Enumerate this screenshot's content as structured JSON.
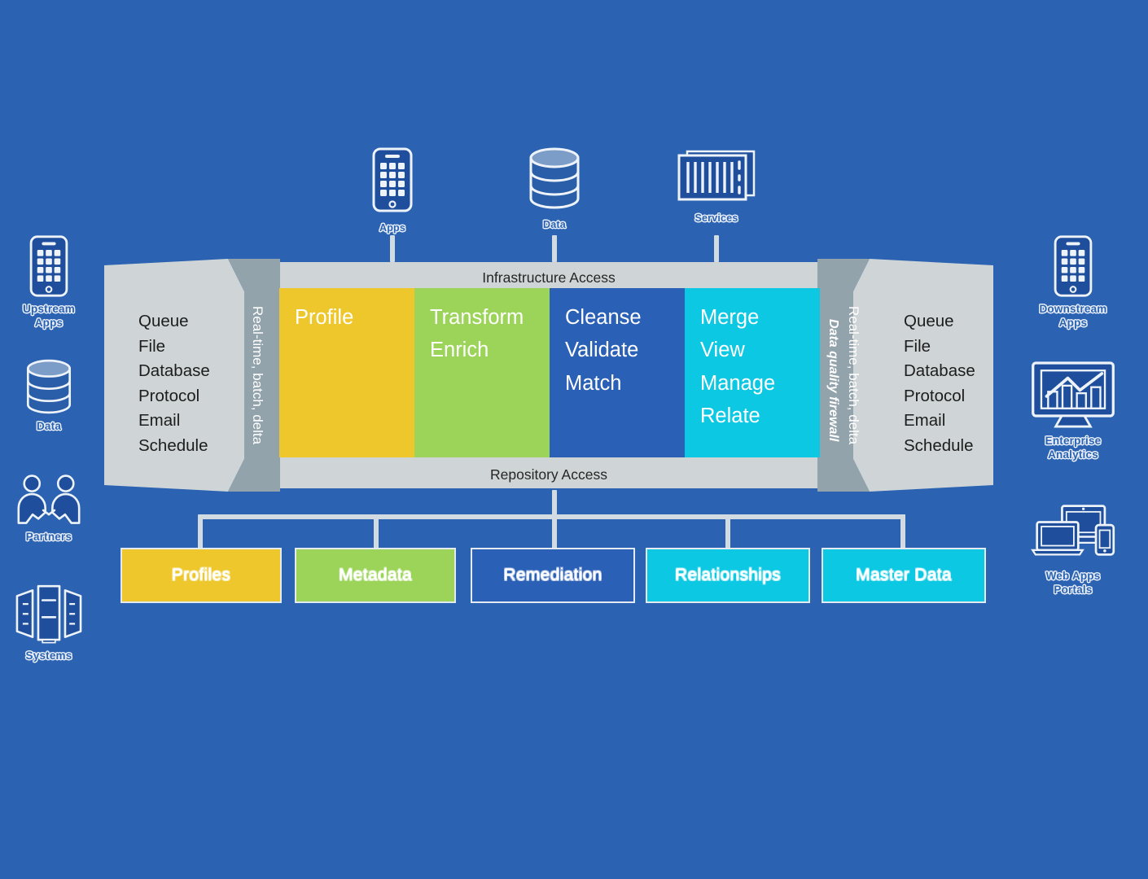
{
  "theme": {
    "background": "#2b63b2",
    "band_light": "#cfd5d6",
    "band_dark": "#93a3ac",
    "connector": "#d3dbe2",
    "icon_fill": "#1f4f9c",
    "yellow": "#edc72b",
    "green": "#9bd458",
    "blue": "#2a60b5",
    "cyan": "#0dc8e3"
  },
  "top_sources": [
    {
      "label": "Apps",
      "icon": "mobile-phone-icon"
    },
    {
      "label": "Data",
      "icon": "database-cylinder-icon"
    },
    {
      "label": "Services",
      "icon": "server-rack-icon"
    }
  ],
  "left_actors": [
    {
      "label": "Upstream\nApps",
      "line1": "Upstream",
      "line2": "Apps",
      "icon": "mobile-phone-icon"
    },
    {
      "label": "Data",
      "line1": "Data",
      "line2": "",
      "icon": "database-cylinder-icon"
    },
    {
      "label": "Partners",
      "line1": "Partners",
      "line2": "",
      "icon": "handshake-icon"
    },
    {
      "label": "Systems",
      "line1": "Systems",
      "line2": "",
      "icon": "server-towers-icon"
    }
  ],
  "right_actors": [
    {
      "line1": "Downstream",
      "line2": "Apps",
      "icon": "mobile-phone-icon"
    },
    {
      "line1": "Enterprise",
      "line2": "Analytics",
      "icon": "analytics-monitor-icon"
    },
    {
      "line1": "Web Apps",
      "line2": "Portals",
      "icon": "multi-device-icon"
    }
  ],
  "band": {
    "top_access_label": "Infrastructure Access",
    "bottom_access_label": "Repository Access",
    "left_channels": [
      "Queue",
      "File",
      "Database",
      "Protocol",
      "Email",
      "Schedule"
    ],
    "right_channels": [
      "Queue",
      "File",
      "Database",
      "Protocol",
      "Email",
      "Schedule"
    ],
    "left_strip_label": "Real-time, batch, delta",
    "right_strip_label": "Real-time, batch, delta",
    "firewall_label": "Data quality firewall"
  },
  "core_blocks": [
    {
      "name": "profile",
      "color": "#edc72b",
      "lines": [
        "Profile"
      ]
    },
    {
      "name": "transform",
      "color": "#9bd458",
      "lines": [
        "Transform",
        "Enrich"
      ]
    },
    {
      "name": "cleanse",
      "color": "#2a60b5",
      "lines": [
        "Cleanse",
        "Validate",
        "Match"
      ]
    },
    {
      "name": "merge",
      "color": "#0dc8e3",
      "lines": [
        "Merge",
        "View",
        "Manage",
        "Relate"
      ]
    }
  ],
  "repositories": [
    {
      "label": "Profiles",
      "color": "#edc72b"
    },
    {
      "label": "Metadata",
      "color": "#9bd458"
    },
    {
      "label": "Remediation",
      "color": "#2a60b5"
    },
    {
      "label": "Relationships",
      "color": "#0dc8e3"
    },
    {
      "label": "Master Data",
      "color": "#0dc8e3"
    }
  ]
}
